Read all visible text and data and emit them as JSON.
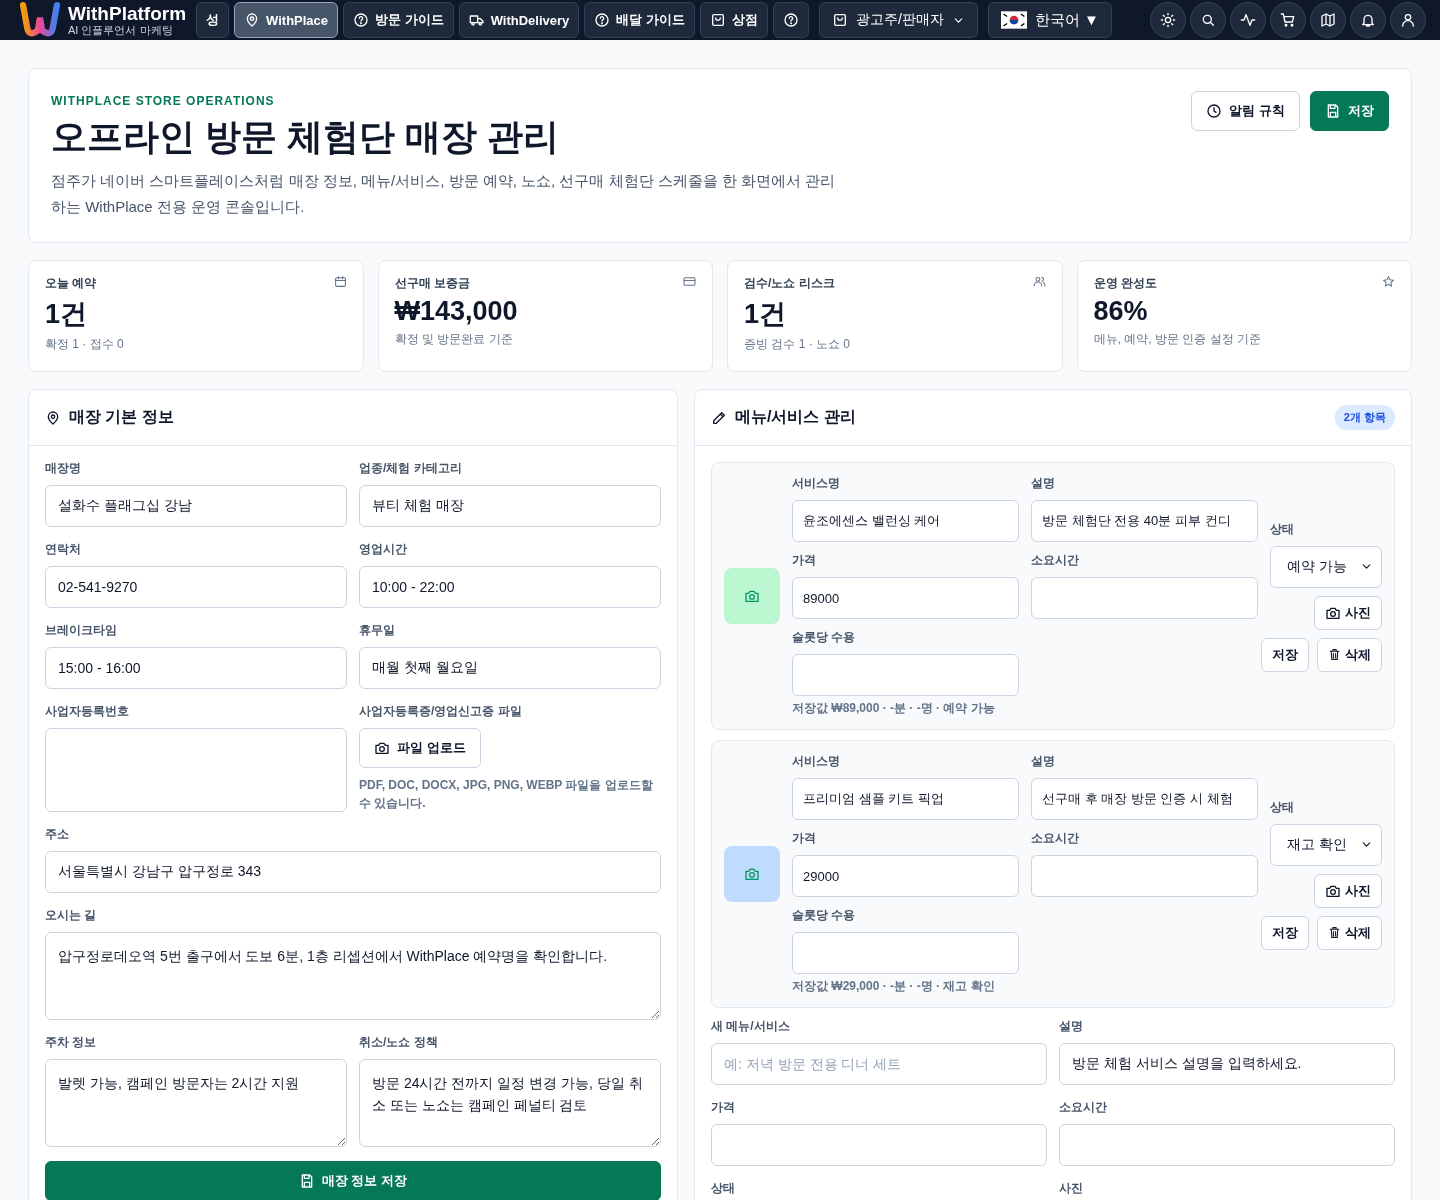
{
  "nav": {
    "logo": {
      "title": "WithPlatform",
      "subtitle": "AI 인플루언서 마케팅"
    },
    "items": [
      {
        "label": "성",
        "selected": false
      },
      {
        "label": "WithPlace",
        "selected": true
      },
      {
        "label": "방문 가이드",
        "selected": false
      },
      {
        "label": "WithDelivery",
        "selected": false
      },
      {
        "label": "배달 가이드",
        "selected": false
      },
      {
        "label": "상점",
        "selected": false
      },
      {
        "selected": false
      }
    ],
    "role": {
      "label": "광고주/판매자"
    },
    "language": {
      "label": "한국어",
      "caret": "▼"
    }
  },
  "header": {
    "eyebrow": "WITHPLACE STORE OPERATIONS",
    "title": "오프라인 방문 체험단 매장 관리",
    "description": "점주가 네이버 스마트플레이스처럼 매장 정보, 메뉴/서비스, 방문 예약, 노쇼, 선구매 체험단 스케줄을 한 화면에서 관리하는 WithPlace 전용 운영 콘솔입니다.",
    "buttons": [
      {
        "label": "알림 규칙",
        "kind": "outline"
      },
      {
        "label": "저장",
        "kind": "primary"
      }
    ]
  },
  "stats": [
    {
      "label": "오늘 예약",
      "value": "1건",
      "note": "확정 1 · 접수 0"
    },
    {
      "label": "선구매 보증금",
      "value": "₩143,000",
      "note": "확정 및 방문완료 기준"
    },
    {
      "label": "검수/노쇼 리스크",
      "value": "1건",
      "note": "증빙 검수 1 · 노쇼 0"
    },
    {
      "label": "운영 완성도",
      "value": "86%",
      "note": "메뉴, 예약, 방문 인증 설정 기준"
    }
  ],
  "store_info": {
    "title": "매장 기본 정보",
    "rows": [
      [
        {
          "label": "매장명",
          "kind": "input",
          "value": "설화수 플래그십 강남"
        },
        {
          "label": "업종/체험 카테고리",
          "kind": "input",
          "value": "뷰티 체험 매장"
        }
      ],
      [
        {
          "label": "연락처",
          "kind": "input",
          "value": "02-541-9270"
        },
        {
          "label": "영업시간",
          "kind": "input",
          "value": "10:00 - 22:00"
        }
      ],
      [
        {
          "label": "브레이크타임",
          "kind": "input",
          "value": "15:00 - 16:00"
        },
        {
          "label": "휴무일",
          "kind": "input",
          "value": "매월 첫째 월요일"
        }
      ],
      [
        {
          "label": "사업자등록번호",
          "kind": "input"
        },
        {
          "label": "사업자등록증/영업신고증 파일",
          "kind": "upload",
          "button": "파일 업로드",
          "hint": "PDF, DOC, DOCX, JPG, PNG, WEBP 파일을 업로드할 수 있습니다."
        }
      ],
      [
        {
          "label": "주소",
          "kind": "input",
          "value": "서울특별시 강남구 압구정로 343"
        }
      ],
      [
        {
          "label": "오시는 길",
          "kind": "textarea",
          "value": "압구정로데오역 5번 출구에서 도보 6분, 1층 리셉션에서 WithPlace 예약명을 확인합니다."
        }
      ],
      [
        {
          "label": "주차 정보",
          "kind": "textarea",
          "value": "발렛 가능, 캠페인 방문자는 2시간 지원"
        },
        {
          "label": "취소/노쇼 정책",
          "kind": "textarea",
          "value": "방문 24시간 전까지 일정 변경 가능, 당일 취소 또는 노쇼는 캠페인 페널티 검토"
        }
      ]
    ],
    "save_button": "매장 정보 저장"
  },
  "menu": {
    "title": "메뉴/서비스 관리",
    "count": "2개 항목",
    "items": [
      {
        "color": "#bbf7d0",
        "fields": [
          {
            "label": "서비스명",
            "value": "윤조에센스 밸런싱 케어"
          },
          {
            "label": "설명",
            "value": "방문 체험단 전용 40분 피부 컨디"
          },
          {
            "label": "가격",
            "value": "89000"
          },
          {
            "label": "소요시간"
          },
          {
            "label": "슬롯당 수용"
          }
        ],
        "status_label": "상태",
        "status": "예약 가능",
        "summary": "저장값 ₩89,000 · -분 · -명 · 예약 가능",
        "photo_button": "사진",
        "save_button": "저장",
        "delete_button": "삭제"
      },
      {
        "color": "#bfdbfe",
        "fields": [
          {
            "label": "서비스명",
            "value": "프리미엄 샘플 키트 픽업"
          },
          {
            "label": "설명",
            "value": "선구매 후 매장 방문 인증 시 체험"
          },
          {
            "label": "가격",
            "value": "29000"
          },
          {
            "label": "소요시간"
          },
          {
            "label": "슬롯당 수용"
          }
        ],
        "status_label": "상태",
        "status": "재고 확인",
        "summary": "저장값 ₩29,000 · -분 · -명 · 재고 확인",
        "photo_button": "사진",
        "save_button": "저장",
        "delete_button": "삭제"
      }
    ],
    "new_form": {
      "fields": [
        {
          "label": "새 메뉴/서비스",
          "placeholder": "예: 저녁 방문 전용 디너 세트"
        },
        {
          "label": "설명",
          "value": "방문 체험 서비스 설명을 입력하세요."
        },
        {
          "label": "가격"
        },
        {
          "label": "소요시간"
        }
      ],
      "labels": [
        "상태",
        "사진"
      ]
    }
  }
}
